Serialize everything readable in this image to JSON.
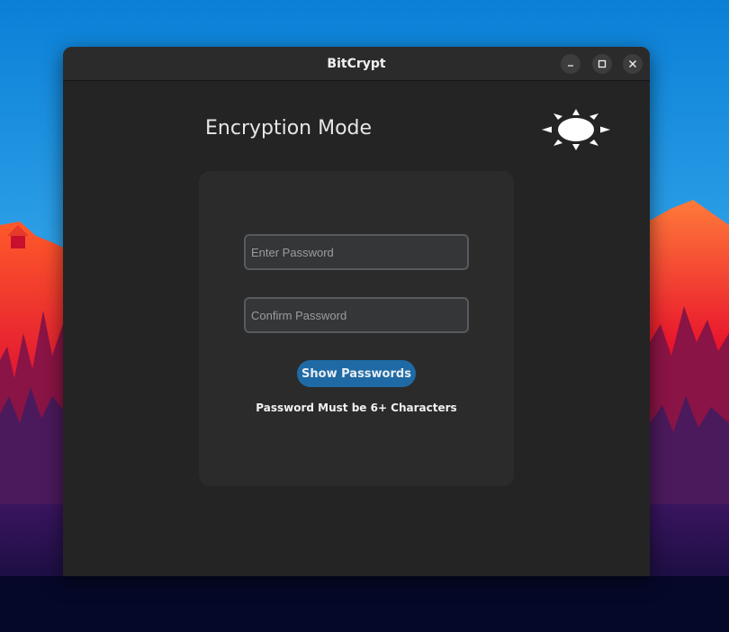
{
  "window": {
    "title": "BitCrypt",
    "controls": {
      "minimize_icon": "minimize-icon",
      "maximize_icon": "maximize-icon",
      "close_icon": "close-icon"
    }
  },
  "main": {
    "heading": "Encryption Mode",
    "theme_toggle_icon": "sun-icon"
  },
  "form": {
    "password_placeholder": "Enter Password",
    "confirm_placeholder": "Confirm Password",
    "password_value": "",
    "confirm_value": "",
    "show_button_label": "Show Passwords",
    "hint": "Password Must be 6+ Characters"
  },
  "colors": {
    "window_bg": "#242424",
    "card_bg": "#2b2b2b",
    "accent": "#1f6aa5",
    "field_bg": "#343638",
    "field_border": "#565b5e"
  }
}
